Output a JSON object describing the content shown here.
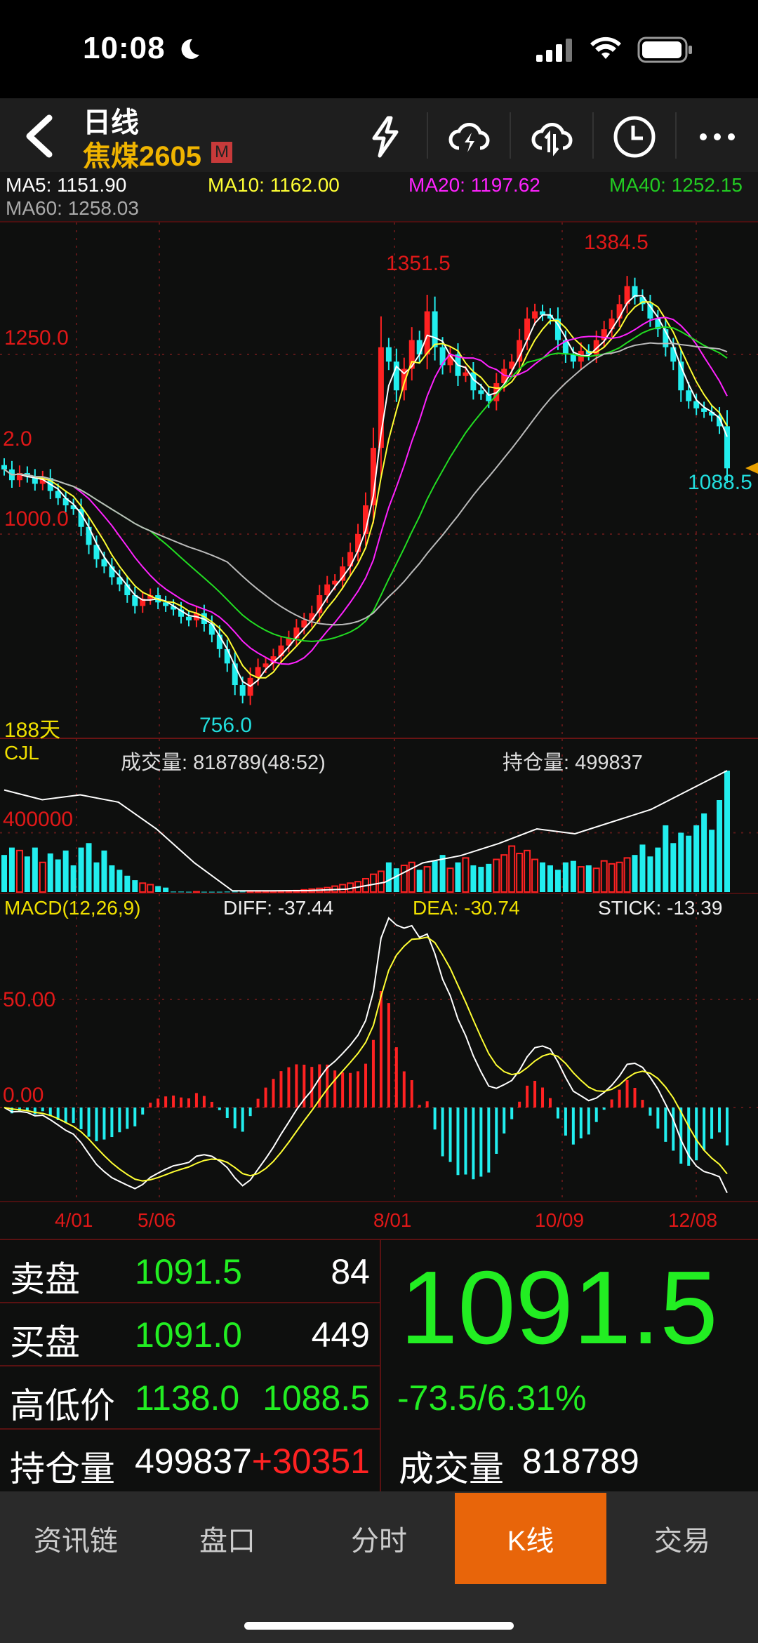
{
  "status_bar": {
    "time": "10:08"
  },
  "header": {
    "title": "日线",
    "symbol": "焦煤2605",
    "badge": "M",
    "icons": [
      "lightning-icon",
      "cloud-lightning-icon",
      "cloud-sync-icon",
      "clock-icon",
      "more-icon"
    ]
  },
  "ma_legend": {
    "ma5": "MA5: 1151.90",
    "ma10": "MA10: 1162.00",
    "ma20": "MA20: 1197.62",
    "ma40": "MA40: 1252.15",
    "ma60": "MA60: 1258.03"
  },
  "colors": {
    "ma5": "#ffffff",
    "ma10": "#ffff33",
    "ma20": "#ff22ff",
    "ma40": "#22dd22",
    "ma60": "#bbbbbb",
    "up": "#ff2222",
    "down": "#22eeee",
    "accent": "#e8650a"
  },
  "main_chart": {
    "label_1250": "1250.0",
    "label_partial": "2.0",
    "label_1000": "1000.0",
    "high_1": "1351.5",
    "high_2": "1384.5",
    "low": "756.0",
    "last_low": "1088.5",
    "days": "188天"
  },
  "volume_panel": {
    "name": "CJL",
    "volume_text": "成交量: 818789(48:52)",
    "oi_text": "持仓量: 499837",
    "label_400000": "400000"
  },
  "macd_panel": {
    "name": "MACD(12,26,9)",
    "diff": "DIFF: -37.44",
    "dea": "DEA: -30.74",
    "stick": "STICK: -13.39",
    "label_50": "50.00",
    "label_0": "0.00"
  },
  "date_axis": [
    "4/01",
    "5/06",
    "8/01",
    "10/09",
    "12/08"
  ],
  "quote": {
    "rows": [
      {
        "label": "卖盘",
        "price": "1091.5",
        "qty": "84"
      },
      {
        "label": "买盘",
        "price": "1091.0",
        "qty": "449"
      },
      {
        "label": "高低价",
        "price": "1138.0",
        "qty": "1088.5"
      },
      {
        "label": "持仓量",
        "price": "499837",
        "qty": "+30351"
      }
    ],
    "last_price": "1091.5",
    "change": "-73.5/6.31%",
    "volume_label": "成交量",
    "volume_value": "818789"
  },
  "tabs": [
    {
      "label": "资讯链"
    },
    {
      "label": "盘口"
    },
    {
      "label": "分时"
    },
    {
      "label": "K线",
      "active": true
    },
    {
      "label": "交易"
    }
  ],
  "chart_data": {
    "type": "candlestick",
    "title": "焦煤2605 日线",
    "closes": [
      1090,
      1075,
      1085,
      1080,
      1070,
      1078,
      1060,
      1050,
      1040,
      1035,
      1010,
      985,
      965,
      955,
      940,
      930,
      915,
      900,
      910,
      915,
      905,
      900,
      895,
      885,
      880,
      890,
      875,
      860,
      840,
      820,
      790,
      775,
      800,
      815,
      820,
      830,
      845,
      855,
      870,
      880,
      890,
      915,
      930,
      935,
      955,
      975,
      1000,
      1040,
      1120,
      1260,
      1240,
      1200,
      1230,
      1270,
      1250,
      1310,
      1260,
      1235,
      1250,
      1220,
      1225,
      1200,
      1195,
      1185,
      1210,
      1230,
      1240,
      1270,
      1300,
      1310,
      1305,
      1300,
      1270,
      1250,
      1240,
      1255,
      1250,
      1270,
      1285,
      1300,
      1320,
      1345,
      1330,
      1320,
      1300,
      1285,
      1260,
      1240,
      1200,
      1185,
      1175,
      1170,
      1165,
      1150,
      1091.5
    ],
    "volumes": [
      250000,
      300000,
      280000,
      240000,
      300000,
      200000,
      260000,
      220000,
      280000,
      180000,
      300000,
      330000,
      200000,
      280000,
      180000,
      150000,
      110000,
      80000,
      60000,
      50000,
      40000,
      30000,
      3000,
      3000,
      2000,
      2000,
      2000,
      2000,
      2000,
      3000,
      3000,
      3000,
      4000,
      4000,
      5000,
      5000,
      6000,
      8000,
      10000,
      15000,
      20000,
      25000,
      30000,
      40000,
      50000,
      60000,
      70000,
      90000,
      120000,
      140000,
      200000,
      160000,
      180000,
      200000,
      150000,
      170000,
      210000,
      250000,
      160000,
      200000,
      230000,
      180000,
      170000,
      190000,
      220000,
      250000,
      310000,
      260000,
      280000,
      220000,
      200000,
      180000,
      150000,
      200000,
      210000,
      170000,
      180000,
      160000,
      210000,
      190000,
      200000,
      230000,
      250000,
      320000,
      240000,
      300000,
      450000,
      330000,
      400000,
      380000,
      450000,
      530000,
      420000,
      620000,
      818789
    ],
    "open_interest": [
      420000,
      380000,
      400000,
      370000,
      260000,
      120000,
      5000,
      5000,
      6000,
      12000,
      40000,
      120000,
      150000,
      200000,
      260000,
      240000,
      290000,
      340000,
      420000,
      499837
    ],
    "ylim": [
      740,
      1400
    ]
  }
}
